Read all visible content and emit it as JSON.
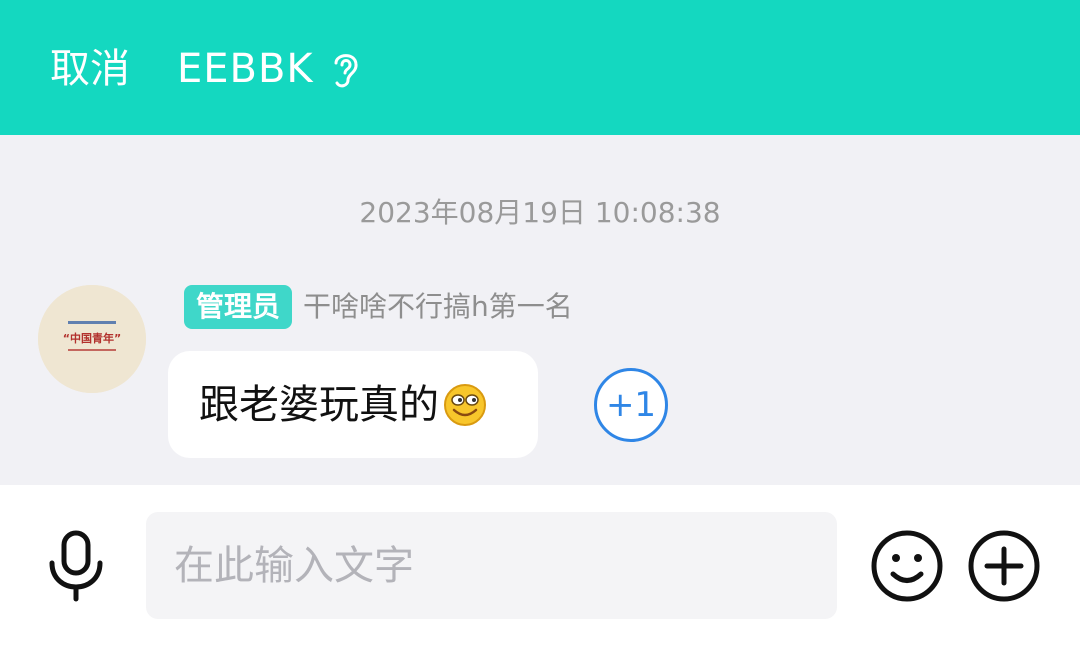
{
  "header": {
    "cancel_label": "取消",
    "title": "EEBBK",
    "title_icon": "ear-icon",
    "background_color": "#14d8c0"
  },
  "chat": {
    "timestamp": "2023年08月19日 10:08:38",
    "messages": [
      {
        "role_badge": "管理员",
        "sender_name": "干啥啥不行搞h第一名",
        "avatar_icon": "avatar-china-youth",
        "avatar_text": "“中国青年”",
        "text": "跟老婆玩真的",
        "emoji_icon": "smiling-emoji-icon",
        "reaction": "+1"
      }
    ]
  },
  "input_bar": {
    "voice_icon": "microphone-icon",
    "placeholder": "在此输入文字",
    "value": "",
    "emoji_button_icon": "smile-icon",
    "more_button_icon": "plus-circle-icon"
  }
}
